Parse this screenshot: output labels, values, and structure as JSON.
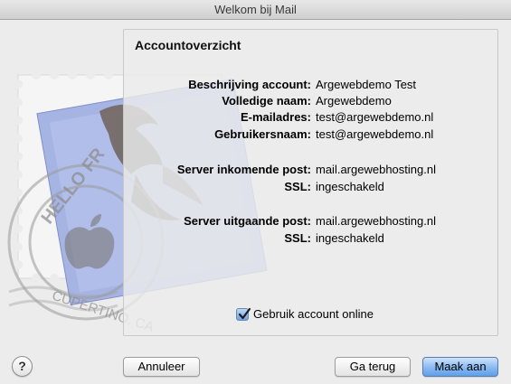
{
  "window": {
    "title": "Welkom bij Mail"
  },
  "stamp": {
    "text_top": "HELLO FR",
    "text_bottom": "CUPERTINO, CA"
  },
  "panel": {
    "title": "Accountoverzicht",
    "rows": [
      {
        "label": "Beschrijving account:",
        "value": "Argewebdemo Test"
      },
      {
        "label": "Volledige naam:",
        "value": "Argewebdemo"
      },
      {
        "label": "E-mailadres:",
        "value": "test@argewebdemo.nl"
      },
      {
        "label": "Gebruikersnaam:",
        "value": "test@argewebdemo.nl"
      },
      {
        "label": "Server inkomende post:",
        "value": "mail.argewebhosting.nl"
      },
      {
        "label": "SSL:",
        "value": "ingeschakeld"
      },
      {
        "label": "Server uitgaande post:",
        "value": "mail.argewebhosting.nl"
      },
      {
        "label": "SSL:",
        "value": "ingeschakeld"
      }
    ],
    "checkbox": {
      "label": "Gebruik account online",
      "checked": true
    }
  },
  "buttons": {
    "help": "?",
    "cancel": "Annuleer",
    "back": "Ga terug",
    "create": "Maak aan"
  },
  "colors": {
    "accent": "#5e9ee9",
    "stamp_blue": "#9fb0e0"
  }
}
